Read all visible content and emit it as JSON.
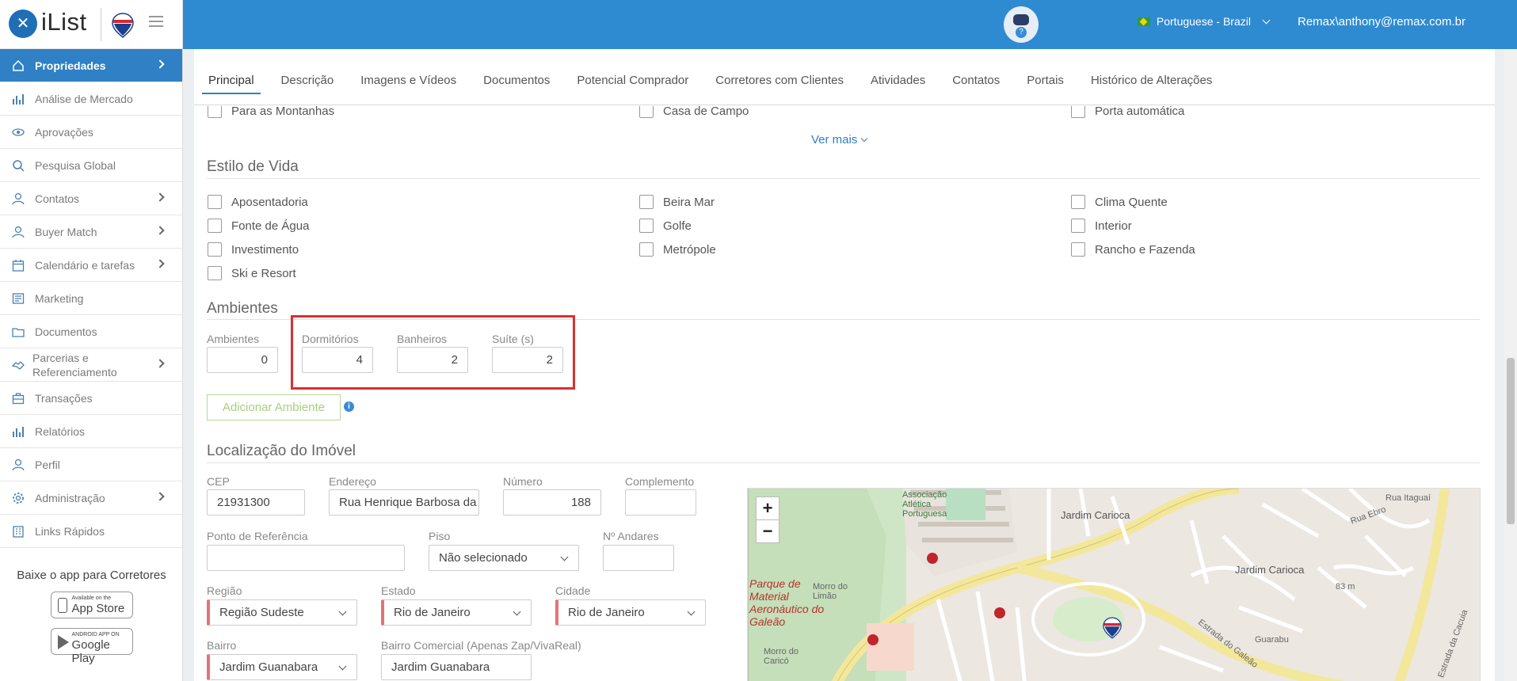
{
  "sidebar": {
    "logo_mark": "✕",
    "logo_text": "iList",
    "items": [
      {
        "label": "Propriedades",
        "icon": "home-icon",
        "active": true
      },
      {
        "label": "Análise de Mercado",
        "icon": "bar-chart-icon"
      },
      {
        "label": "Aprovações",
        "icon": "eye-icon"
      },
      {
        "label": "Pesquisa Global",
        "icon": "search-icon"
      },
      {
        "label": "Contatos",
        "icon": "user-icon"
      },
      {
        "label": "Buyer Match",
        "icon": "user-icon"
      },
      {
        "label": "Calendário e tarefas",
        "icon": "calendar-icon"
      },
      {
        "label": "Marketing",
        "icon": "newspaper-icon"
      },
      {
        "label": "Documentos",
        "icon": "folder-icon"
      },
      {
        "label": "Parcerias e Referenciamento",
        "icon": "handshake-icon"
      },
      {
        "label": "Transações",
        "icon": "briefcase-icon"
      },
      {
        "label": "Relatórios",
        "icon": "bar-chart-icon"
      },
      {
        "label": "Perfil",
        "icon": "user-icon"
      },
      {
        "label": "Administração",
        "icon": "gear-icon"
      },
      {
        "label": "Links Rápidos",
        "icon": "building-icon"
      }
    ],
    "promo": {
      "title": "Baixe o app para Corretores",
      "appstore_small": "Available on the",
      "appstore_big": "App Store",
      "play_small": "ANDROID APP ON",
      "play_big": "Google Play"
    }
  },
  "topbar": {
    "language": "Portuguese - Brazil",
    "user": "Remax\\anthony@remax.com.br"
  },
  "tabs": [
    "Principal",
    "Descrição",
    "Imagens e Vídeos",
    "Documentos",
    "Potencial Comprador",
    "Corretores com Clientes",
    "Atividades",
    "Contatos",
    "Portais",
    "Histórico de Alterações"
  ],
  "prev_row": [
    "Para as Montanhas",
    "Casa de Campo",
    "Porta automática"
  ],
  "ver_mais": "Ver mais",
  "estilo": {
    "title": "Estilo de Vida",
    "items": [
      "Aposentadoria",
      "Beira Mar",
      "Clima Quente",
      "Fonte de Água",
      "Golfe",
      "Interior",
      "Investimento",
      "Metrópole",
      "Rancho e Fazenda",
      "Ski e Resort"
    ]
  },
  "ambientes": {
    "title": "Ambientes",
    "fields": [
      {
        "label": "Ambientes",
        "value": "0"
      },
      {
        "label": "Dormitórios",
        "value": "4"
      },
      {
        "label": "Banheiros",
        "value": "2"
      },
      {
        "label": "Suíte (s)",
        "value": "2"
      }
    ],
    "add_button": "Adicionar Ambiente",
    "info": "i"
  },
  "localizacao": {
    "title": "Localização do Imóvel",
    "cep": {
      "label": "CEP",
      "value": "21931300"
    },
    "endereco": {
      "label": "Endereço",
      "value": "Rua Henrique Barbosa da"
    },
    "numero": {
      "label": "Número",
      "value": "188"
    },
    "complemento": {
      "label": "Complemento",
      "value": ""
    },
    "referencia": {
      "label": "Ponto de Referência",
      "value": ""
    },
    "piso": {
      "label": "Piso",
      "value": "Não selecionado"
    },
    "andares": {
      "label": "Nº Andares",
      "value": ""
    },
    "regiao": {
      "label": "Região",
      "value": "Região Sudeste"
    },
    "estado": {
      "label": "Estado",
      "value": "Rio de Janeiro"
    },
    "cidade": {
      "label": "Cidade",
      "value": "Rio de Janeiro"
    },
    "bairro": {
      "label": "Bairro",
      "value": "Jardim Guanabara"
    },
    "bairro_comercial": {
      "label": "Bairro Comercial (Apenas Zap/VivaReal)",
      "value": "Jardim Guanabara"
    }
  },
  "map": {
    "zoom_in": "+",
    "zoom_out": "−",
    "labels": {
      "jc1": "Jardim Carioca",
      "jc2": "Jardim Carioca",
      "park": "Parque de Material Aeronáutico do Galeão",
      "assoc": "Associação Atlética Portuguesa",
      "morro1": "Morro do Limão",
      "morro2": "Morro do Caricó",
      "estrada1": "Estrada do Galeão",
      "estrada2": "Estrada da Cacuia",
      "altitude": "83 m",
      "guarabu": "Guarabu",
      "ilha": "Rua Itaguaí",
      "ebro": "Rua Ebro"
    }
  }
}
